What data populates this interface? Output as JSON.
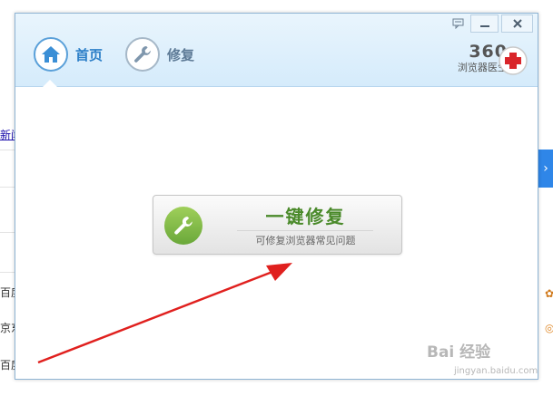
{
  "window": {
    "nav": [
      {
        "label": "首页",
        "icon": "home-icon"
      },
      {
        "label": "修复",
        "icon": "wrench-icon"
      }
    ],
    "controls": {
      "feedback": "feedback-icon",
      "minimize": "minimize-icon",
      "close": "close-icon"
    },
    "brand": {
      "number": "360",
      "subtitle": "浏览器医生",
      "logo": "red-cross-icon"
    }
  },
  "repair_button": {
    "title": "一键修复",
    "subtitle": "可修复浏览器常见问题",
    "icon": "wrench-icon"
  },
  "background_page": {
    "link_fragment": "新闻",
    "rows": [
      "百度",
      "京东",
      "百度"
    ]
  },
  "watermark": {
    "main": "Bai 经验",
    "sub": "jingyan.baidu.com"
  },
  "colors": {
    "header_bg": "#d5ebfb",
    "accent_blue": "#2c7fc8",
    "repair_green": "#4a8a2a",
    "arrow_red": "#e0201e"
  }
}
